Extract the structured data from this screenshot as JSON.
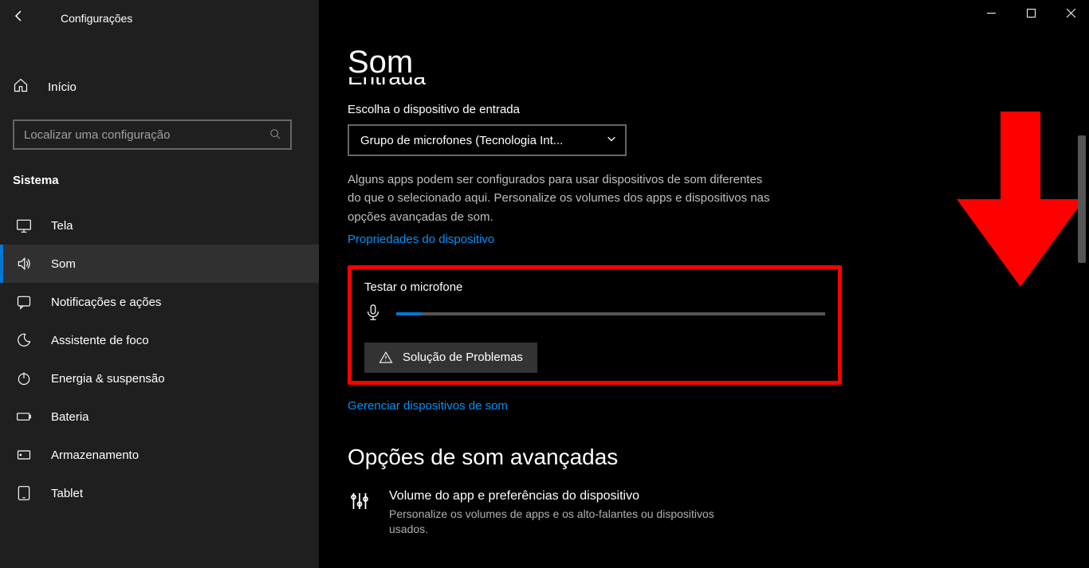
{
  "window": {
    "title": "Configurações"
  },
  "sidebar": {
    "home": "Início",
    "search_placeholder": "Localizar uma configuração",
    "category": "Sistema",
    "items": [
      {
        "label": "Tela",
        "icon": "display"
      },
      {
        "label": "Som",
        "icon": "sound",
        "active": true
      },
      {
        "label": "Notificações e ações",
        "icon": "message"
      },
      {
        "label": "Assistente de foco",
        "icon": "moon"
      },
      {
        "label": "Energia & suspensão",
        "icon": "power"
      },
      {
        "label": "Bateria",
        "icon": "battery"
      },
      {
        "label": "Armazenamento",
        "icon": "storage"
      },
      {
        "label": "Tablet",
        "icon": "tablet"
      }
    ]
  },
  "main": {
    "page_title": "Som",
    "section_scrolled": "Entrada",
    "input_device_label": "Escolha o dispositivo de entrada",
    "input_device_value": "Grupo de microfones (Tecnologia Int...",
    "input_device_note": "Alguns apps podem ser configurados para usar dispositivos de som diferentes do que o selecionado aqui. Personalize os volumes dos apps e dispositivos nas opções avançadas de som.",
    "device_properties_link": "Propriedades do dispositivo",
    "test_mic_label": "Testar o microfone",
    "mic_level_percent": 6,
    "troubleshoot_label": "Solução de Problemas",
    "manage_devices_link": "Gerenciar dispositivos de som",
    "advanced_heading": "Opções de som avançadas",
    "advanced_item_title": "Volume do app e preferências do dispositivo",
    "advanced_item_desc": "Personalize os volumes de apps e os alto-falantes ou dispositivos usados."
  },
  "annotation": {
    "arrow_color": "#ff0000",
    "highlight_color": "#ff0000"
  }
}
